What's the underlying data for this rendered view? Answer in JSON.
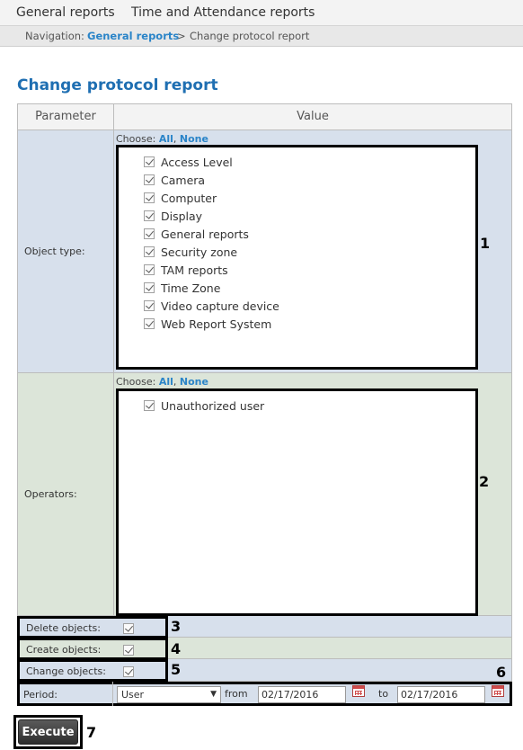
{
  "top_tabs": [
    "General reports",
    "Time and Attendance reports"
  ],
  "navigation": {
    "prefix": "Navigation:",
    "link": "General reports",
    "separator": ">",
    "current": "Change protocol report"
  },
  "page_title": "Change protocol report",
  "table": {
    "col_parameter": "Parameter",
    "col_value": "Value"
  },
  "choose": {
    "label": "Choose:",
    "all": "All",
    "none": "None",
    "comma": ","
  },
  "object_type": {
    "label": "Object type:",
    "items": [
      "Access Level",
      "Camera",
      "Computer",
      "Display",
      "General reports",
      "Security zone",
      "TAM reports",
      "Time Zone",
      "Video capture device",
      "Web Report System"
    ],
    "checked": [
      true,
      true,
      true,
      true,
      true,
      true,
      true,
      true,
      true,
      true
    ]
  },
  "operators": {
    "label": "Operators:",
    "items": [
      "Unauthorized user"
    ],
    "checked": [
      true
    ]
  },
  "delete_objects": {
    "label": "Delete objects:",
    "checked": true
  },
  "create_objects": {
    "label": "Create objects:",
    "checked": true
  },
  "change_objects": {
    "label": "Change objects:",
    "checked": true
  },
  "period": {
    "label": "Period:",
    "selected": "User",
    "from_label": "from",
    "from_date": "02/17/2016",
    "to_label": "to",
    "to_date": "02/17/2016"
  },
  "execute_label": "Execute",
  "callouts": [
    "1",
    "2",
    "3",
    "4",
    "5",
    "6",
    "7"
  ],
  "colors": {
    "title": "#1f6fb2",
    "link": "#2a84c8",
    "row_blue": "#d7e0ec",
    "row_green": "#dce5d9"
  }
}
